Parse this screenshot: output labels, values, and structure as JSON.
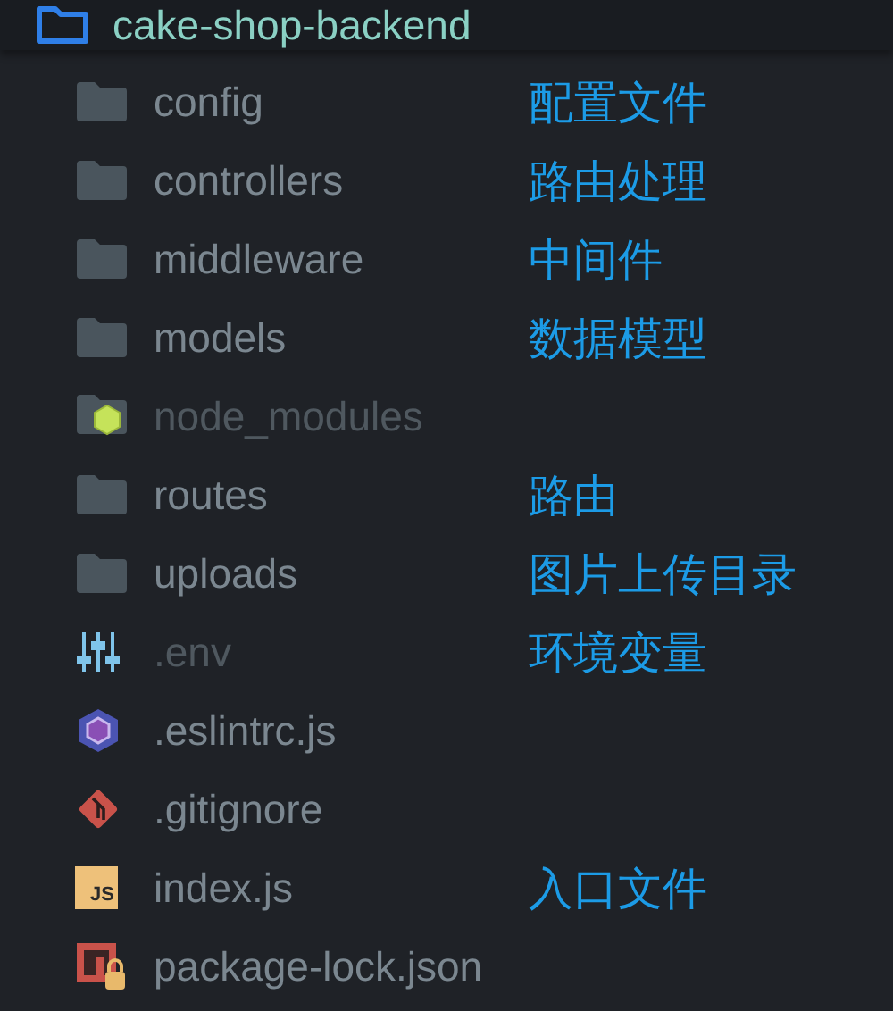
{
  "tree": {
    "root": {
      "label": "cake-shop-backend",
      "expanded": true
    },
    "items": [
      {
        "label": "config",
        "kind": "folder",
        "dimmed": false,
        "note": "配置文件"
      },
      {
        "label": "controllers",
        "kind": "folder",
        "dimmed": false,
        "note": "路由处理"
      },
      {
        "label": "middleware",
        "kind": "folder",
        "dimmed": false,
        "note": "中间件"
      },
      {
        "label": "models",
        "kind": "folder",
        "dimmed": false,
        "note": "数据模型"
      },
      {
        "label": "node_modules",
        "kind": "node-folder",
        "dimmed": true
      },
      {
        "label": "routes",
        "kind": "folder",
        "dimmed": false,
        "note": "路由"
      },
      {
        "label": "uploads",
        "kind": "folder",
        "dimmed": false,
        "note": "图片上传目录"
      },
      {
        "label": ".env",
        "kind": "env",
        "dimmed": true,
        "note": "环境变量"
      },
      {
        "label": ".eslintrc.js",
        "kind": "eslint",
        "dimmed": false
      },
      {
        "label": ".gitignore",
        "kind": "git",
        "dimmed": false
      },
      {
        "label": "index.js",
        "kind": "js",
        "icon_text": "JS",
        "dimmed": false,
        "note": "入口文件"
      },
      {
        "label": "package-lock.json",
        "kind": "npm",
        "dimmed": false
      }
    ]
  }
}
